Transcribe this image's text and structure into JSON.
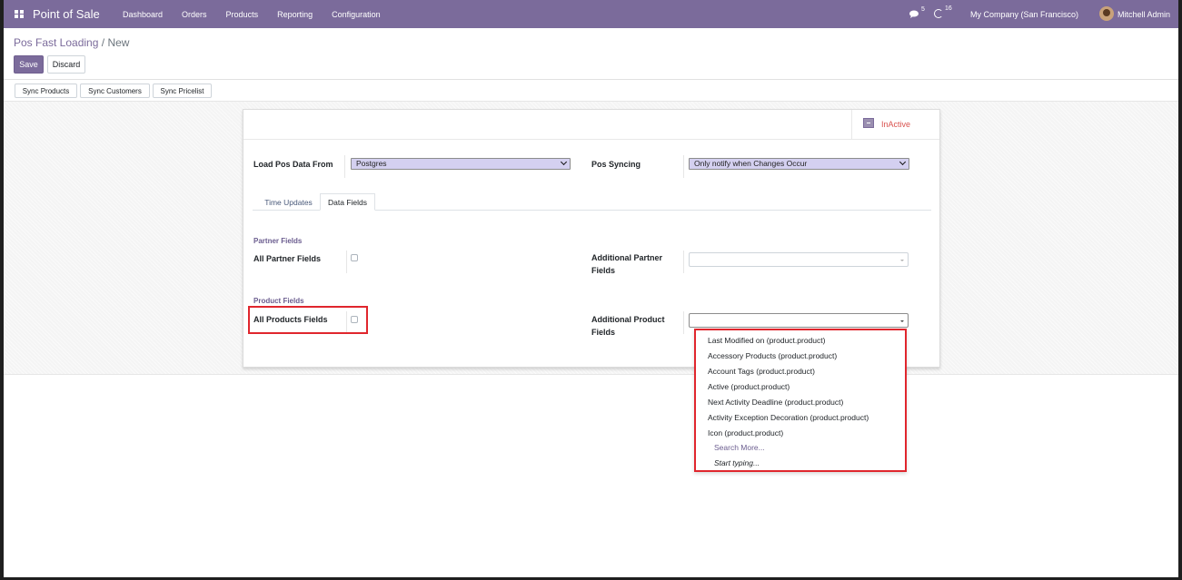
{
  "navbar": {
    "app_name": "Point of Sale",
    "menu": [
      "Dashboard",
      "Orders",
      "Products",
      "Reporting",
      "Configuration"
    ],
    "messages_count": "5",
    "activities_count": "16",
    "company": "My Company (San Francisco)",
    "user": "Mitchell Admin"
  },
  "breadcrumb": {
    "parent": "Pos Fast Loading",
    "separator": "/",
    "current": "New"
  },
  "actions": {
    "save": "Save",
    "discard": "Discard"
  },
  "toolbar": {
    "sync_products": "Sync Products",
    "sync_customers": "Sync Customers",
    "sync_pricelist": "Sync Pricelist"
  },
  "status": {
    "inactive_label": "InActive"
  },
  "form": {
    "load_from_label": "Load Pos Data From",
    "load_from_value": "Postgres",
    "syncing_label": "Pos Syncing",
    "syncing_value": "Only notify when Changes Occur",
    "tabs": [
      "Time Updates",
      "Data Fields"
    ],
    "active_tab": "Data Fields",
    "partner_group_title": "Partner Fields",
    "all_partner_fields_label": "All Partner Fields",
    "additional_partner_fields_label_1": "Additional Partner",
    "additional_partner_fields_label_2": "Fields",
    "product_group_title": "Product Fields",
    "all_products_fields_label": "All Products Fields",
    "additional_product_fields_label_1": "Additional Product",
    "additional_product_fields_label_2": "Fields"
  },
  "dropdown": {
    "items": [
      "Last Modified on (product.product)",
      "Accessory Products (product.product)",
      "Account Tags (product.product)",
      "Active (product.product)",
      "Next Activity Deadline (product.product)",
      "Activity Exception Decoration (product.product)",
      "Icon (product.product)"
    ],
    "search_more": "Search More...",
    "start_typing": "Start typing..."
  },
  "colors": {
    "brand": "#7b6b9b",
    "highlight": "#e0262d",
    "inactive": "#d9534f"
  }
}
